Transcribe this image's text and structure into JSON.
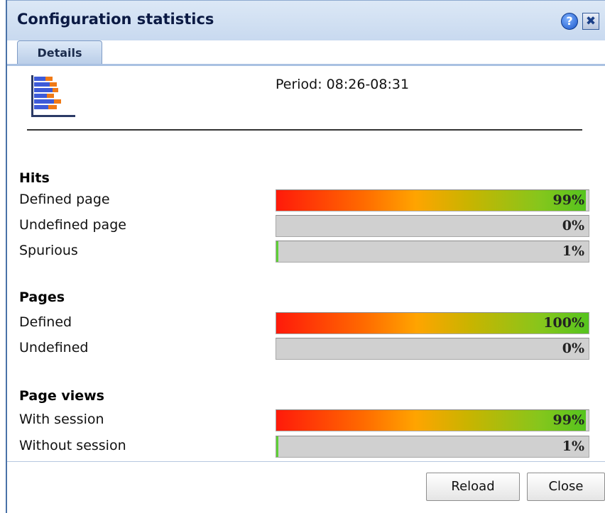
{
  "window": {
    "title": "Configuration statistics"
  },
  "titlebar": {
    "help_glyph": "?",
    "close_glyph": "✖"
  },
  "tabs": [
    {
      "label": "Details"
    }
  ],
  "header": {
    "period": "Period: 08:26-08:31",
    "icon": "bar-chart-icon"
  },
  "sections": [
    {
      "title": "Hits",
      "rows": [
        {
          "label": "Defined page",
          "value_text": "99%",
          "fraction": 0.99
        },
        {
          "label": "Undefined page",
          "value_text": "0%",
          "fraction": 0.0
        },
        {
          "label": "Spurious",
          "value_text": "1%",
          "fraction": 0.01
        }
      ]
    },
    {
      "title": "Pages",
      "rows": [
        {
          "label": "Defined",
          "value_text": "100%",
          "fraction": 1.0
        },
        {
          "label": "Undefined",
          "value_text": "0%",
          "fraction": 0.0
        }
      ]
    },
    {
      "title": "Page views",
      "rows": [
        {
          "label": "With session",
          "value_text": "99%",
          "fraction": 0.99
        },
        {
          "label": "Without session",
          "value_text": "1%",
          "fraction": 0.01
        }
      ]
    }
  ],
  "footer": {
    "reload_label": "Reload",
    "close_label": "Close"
  },
  "colors": {
    "titlebar": "#c8d9ef",
    "window_border": "#4a72a8",
    "bar_track": "#d0d0d0",
    "bar_gradient_start": "#ff1a0a",
    "bar_gradient_end": "#55c41e"
  }
}
